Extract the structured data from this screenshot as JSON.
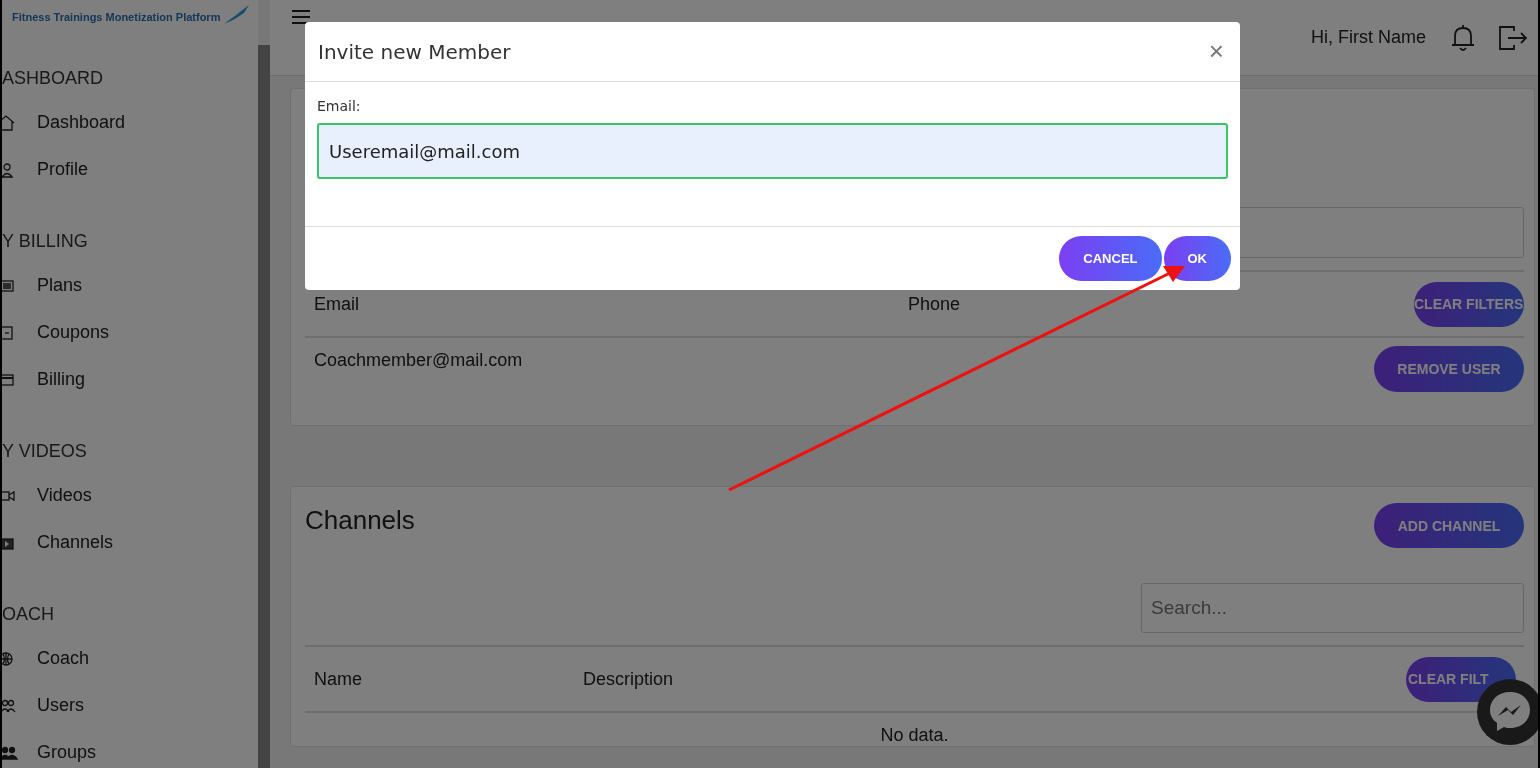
{
  "logo": {
    "text": "Fitness Trainings Monetization Platform"
  },
  "header": {
    "greeting": "Hi, First Name"
  },
  "sidebar": {
    "sections": [
      {
        "title": "ASHBOARD",
        "items": [
          {
            "label": "Dashboard",
            "kind": "home"
          },
          {
            "label": "Profile",
            "kind": "person"
          }
        ]
      },
      {
        "title": "Y BILLING",
        "items": [
          {
            "label": "Plans",
            "kind": "list"
          },
          {
            "label": "Coupons",
            "kind": "coupon"
          },
          {
            "label": "Billing",
            "kind": "card"
          }
        ]
      },
      {
        "title": "Y VIDEOS",
        "items": [
          {
            "label": "Videos",
            "kind": "camera"
          },
          {
            "label": "Channels",
            "kind": "play"
          }
        ]
      },
      {
        "title": "OACH",
        "items": [
          {
            "label": "Coach",
            "kind": "globe"
          },
          {
            "label": "Users",
            "kind": "people"
          },
          {
            "label": "Groups",
            "kind": "group"
          }
        ]
      }
    ]
  },
  "members_card": {
    "columns": [
      "Email",
      "Phone"
    ],
    "clear_filters": "CLEAR FILTERS",
    "rows": [
      {
        "email": "Coachmember@mail.com",
        "action": "REMOVE USER"
      }
    ]
  },
  "channels_card": {
    "title": "Channels",
    "add_button": "ADD CHANNEL",
    "search": {
      "placeholder": "Search..."
    },
    "columns": [
      "Name",
      "Description"
    ],
    "clear_filters": "CLEAR FILT",
    "empty_text": "No data."
  },
  "modal": {
    "title": "Invite new Member",
    "close": "×",
    "field": {
      "label": "Email:",
      "value": "Useremail@mail.com",
      "focused": true
    },
    "buttons": [
      "CANCEL",
      "OK"
    ]
  }
}
